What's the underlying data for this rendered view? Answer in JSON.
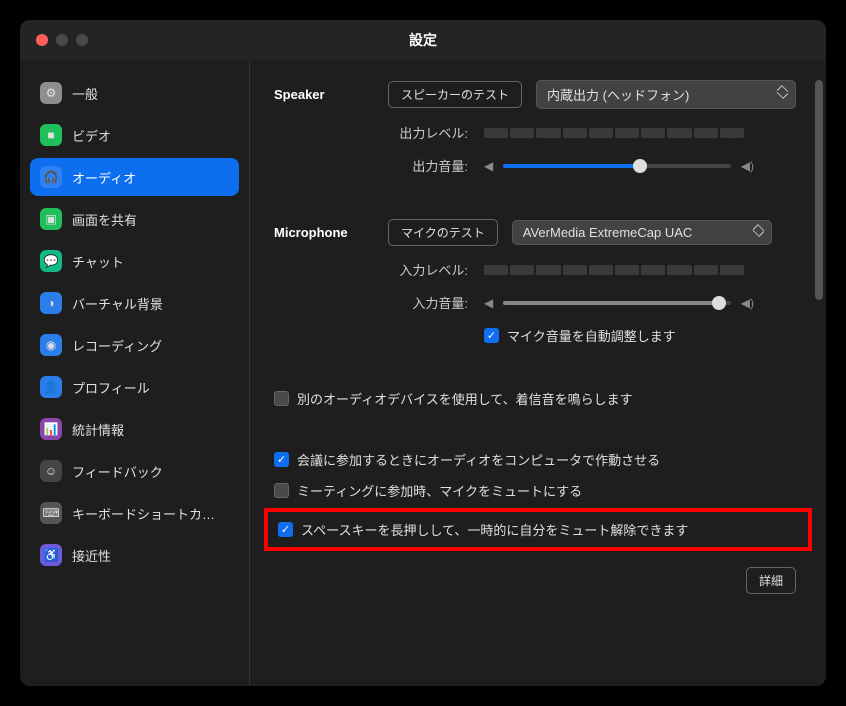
{
  "window": {
    "title": "設定"
  },
  "sidebar": {
    "items": [
      {
        "label": "一般",
        "icon_bg": "#8e8e8e",
        "glyph": "⚙"
      },
      {
        "label": "ビデオ",
        "icon_bg": "#1fbf5c",
        "glyph": "■"
      },
      {
        "label": "オーディオ",
        "icon_bg": "#ffffff22",
        "glyph": "🎧",
        "active": true
      },
      {
        "label": "画面を共有",
        "icon_bg": "#1fbf5c",
        "glyph": "▣"
      },
      {
        "label": "チャット",
        "icon_bg": "#12b886",
        "glyph": "💬"
      },
      {
        "label": "バーチャル背景",
        "icon_bg": "#2b7de9",
        "glyph": "◑"
      },
      {
        "label": "レコーディング",
        "icon_bg": "#2b7de9",
        "glyph": "◉"
      },
      {
        "label": "プロフィール",
        "icon_bg": "#2b7de9",
        "glyph": "👤"
      },
      {
        "label": "統計情報",
        "icon_bg": "#8e44ad",
        "glyph": "📊"
      },
      {
        "label": "フィードバック",
        "icon_bg": "#444",
        "glyph": "☺"
      },
      {
        "label": "キーボードショートカ…",
        "icon_bg": "#555",
        "glyph": "⌨"
      },
      {
        "label": "接近性",
        "icon_bg": "#6b5bdf",
        "glyph": "♿"
      }
    ]
  },
  "speaker": {
    "heading": "Speaker",
    "test_button": "スピーカーのテスト",
    "device": "内蔵出力 (ヘッドフォン)",
    "output_level_label": "出力レベル:",
    "output_volume_label": "出力音量:",
    "volume_percent": 60
  },
  "microphone": {
    "heading": "Microphone",
    "test_button": "マイクのテスト",
    "device": "AVerMedia ExtremeCap UAC",
    "input_level_label": "入力レベル:",
    "input_volume_label": "入力音量:",
    "volume_percent": 95,
    "auto_adjust": {
      "checked": true,
      "label": "マイク音量を自動調整します"
    }
  },
  "options": {
    "ringtone": {
      "checked": false,
      "label": "別のオーディオデバイスを使用して、着信音を鳴らします"
    },
    "join_audio": {
      "checked": true,
      "label": "会議に参加するときにオーディオをコンピュータで作動させる"
    },
    "mute_on_join": {
      "checked": false,
      "label": "ミーティングに参加時、マイクをミュートにする"
    },
    "space_unmute": {
      "checked": true,
      "label": "スペースキーを長押しして、一時的に自分をミュート解除できます"
    }
  },
  "details_button": "詳細"
}
